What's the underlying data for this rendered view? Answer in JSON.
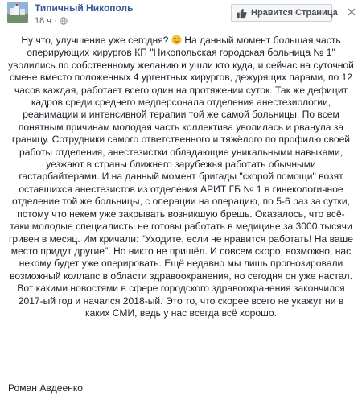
{
  "header": {
    "page_name": "Типичный Никополь",
    "time": "18 ч",
    "like_button_label": "Нравится Страница"
  },
  "post": {
    "text_part1": "Ну что, улучшение уже сегодня?",
    "text_part2": "На данный момент большая часть оперирующих хирургов КП \"Никопольская городская больница № 1\" уволились по собственному желанию и ушли кто куда, и сейчас на суточной смене вместо положенных 4 ургентных хирургов, дежурящих парами, по 12 часов каждая, работает всего один на протяжении суток. Так же дефицит кадров среди среднего медперсонала отделения анестезиологии, реанимации и интенсивной терапии той же самой больницы. По всем понятным причинам молодая часть коллектива уволилась и рванула за границу. Сотрудники самого ответственного и тяжёлого по профилю своей работы отделения, анестезистки обладающие уникальными навыками, уезжают в страны ближнего зарубежья работать обычными гастарбайтерами. И на данный момент бригады \"скорой помощи\" возят оставшихся анестезистов из отделения АРИТ ГБ № 1 в гинекологичное отделение той же больницы, с операции на операцию, по 5-6 раз за сутки, потому что некем уже закрывать возникшую брешь. Оказалось, что всё-таки молодые специалисты не готовы работать в медицине за 3000 тысячи гривен в месяц. Им кричали: \"Уходите, если не нравится работать! На ваше место придут другие\". Но никто не пришёл. И совсем скоро, возможно, нас некому будет уже оперировать. Ещё недавно мы лишь прогнозировали возможный коллапс в области здравоохранения, но сегодня он уже настал. Вот какими новостями в сфере городского здравоохранения закончился 2017-ый год и начался 2018-ый. Это то, что скорее всего не укажут ни в каких СМИ, ведь у нас всегда всё хорошо.",
    "signature": "Роман Авдеенко"
  },
  "colors": {
    "link": "#385898",
    "text": "#1d2129",
    "meta": "#616770",
    "button_bg": "#f5f6f7",
    "button_border": "#ced0d4"
  },
  "icons": {
    "avatar": "page-avatar",
    "globe": "globe-icon",
    "like": "thumbs-up-icon",
    "close": "close-icon",
    "emoji": "winking-tongue-emoji"
  }
}
